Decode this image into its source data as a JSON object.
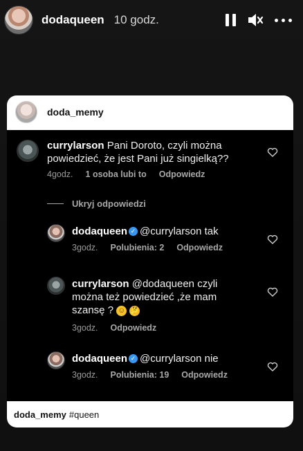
{
  "story": {
    "username": "dodaqueen",
    "time": "10 godz."
  },
  "post": {
    "username": "doda_memy",
    "caption_user": "doda_memy",
    "caption_text": "#queen"
  },
  "thread": {
    "hide_replies_label": "Ukryj odpowiedzi",
    "comments": [
      {
        "username": "currylarson",
        "text_line1": "Pani Doroto, czyli można",
        "text_line2": "powiedzieć, że jest Pani już singielką??",
        "time": "4godz.",
        "likes": "1 osoba lubi to",
        "reply": "Odpowiedz"
      },
      {
        "username": "dodaqueen",
        "verified": true,
        "text": "@currylarson tak",
        "time": "3godz.",
        "likes": "Polubienia: 2",
        "reply": "Odpowiedz"
      },
      {
        "username": "currylarson",
        "text_line1": "@dodaqueen czyli",
        "text_line2": "można też powiedzieć ,że mam",
        "text_line3": "szansę ?",
        "emoji1": "☺",
        "emoji2": "🤔",
        "time": "3godz.",
        "reply": "Odpowiedz"
      },
      {
        "username": "dodaqueen",
        "verified": true,
        "text": "@currylarson nie",
        "time": "3godz.",
        "likes": "Polubienia: 19",
        "reply": "Odpowiedz"
      }
    ]
  },
  "icons": {
    "pause": "pause-icon",
    "mute": "speaker-muted-icon",
    "more": "more-icon",
    "like": "heart-icon",
    "verified": "verified-badge-icon"
  },
  "colors": {
    "verified": "#3897f0",
    "background": "#121212"
  }
}
